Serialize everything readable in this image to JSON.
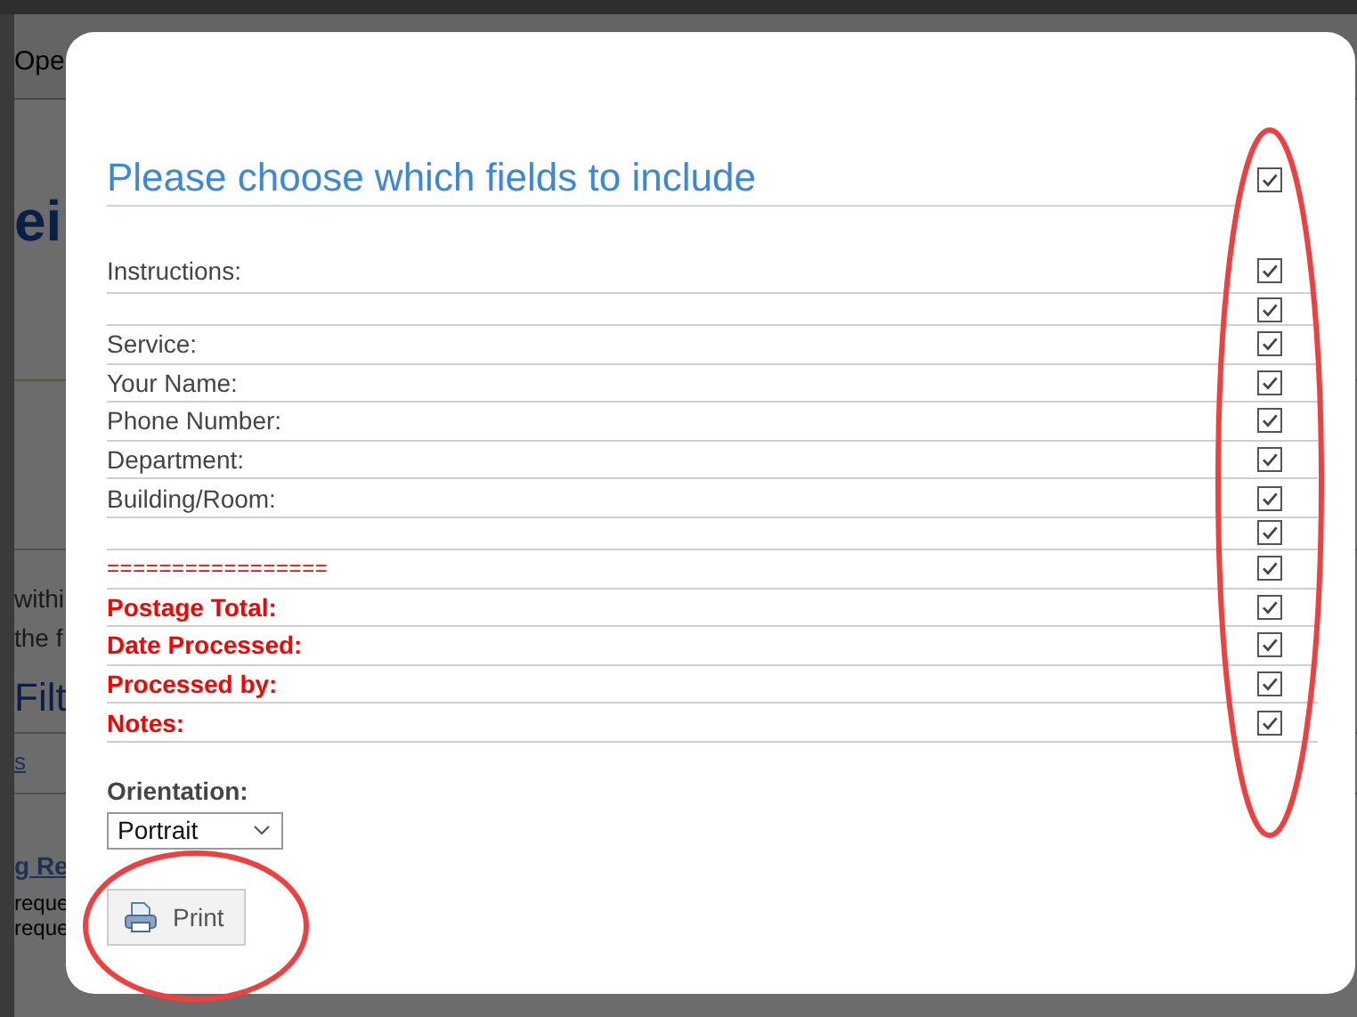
{
  "background": {
    "header_fragment": "Ope",
    "heading_fragment": "ei",
    "paragraph_fragments": [
      "withi",
      "the f"
    ],
    "filter_heading": "Filt",
    "link_fragments": [
      "s",
      "g Re"
    ],
    "small_fragments": [
      "reque",
      "reque"
    ]
  },
  "dialog": {
    "title": "Please choose which fields to include",
    "title_checked": true,
    "fields": [
      {
        "kind": "normal",
        "label": "Instructions:",
        "checked": true
      },
      {
        "kind": "blank",
        "checked": true
      },
      {
        "kind": "normal",
        "label": "Service:",
        "checked": true
      },
      {
        "kind": "normal",
        "label": "Your Name:",
        "checked": true
      },
      {
        "kind": "normal",
        "label": "Phone Number:",
        "checked": true
      },
      {
        "kind": "normal",
        "label": "Department:",
        "checked": true
      },
      {
        "kind": "normal",
        "label": "Building/Room:",
        "checked": true
      },
      {
        "kind": "blank",
        "checked": true
      },
      {
        "kind": "separator",
        "label": "=================",
        "checked": true
      },
      {
        "kind": "emphasis",
        "label": "Postage Total:",
        "checked": true
      },
      {
        "kind": "emphasis",
        "label": "Date Processed:",
        "checked": true
      },
      {
        "kind": "emphasis",
        "label": "Processed by:",
        "checked": true
      },
      {
        "kind": "emphasis",
        "label": "Notes:",
        "checked": true
      }
    ],
    "orientation": {
      "label": "Orientation:",
      "value": "Portrait"
    },
    "print_button": "Print"
  }
}
